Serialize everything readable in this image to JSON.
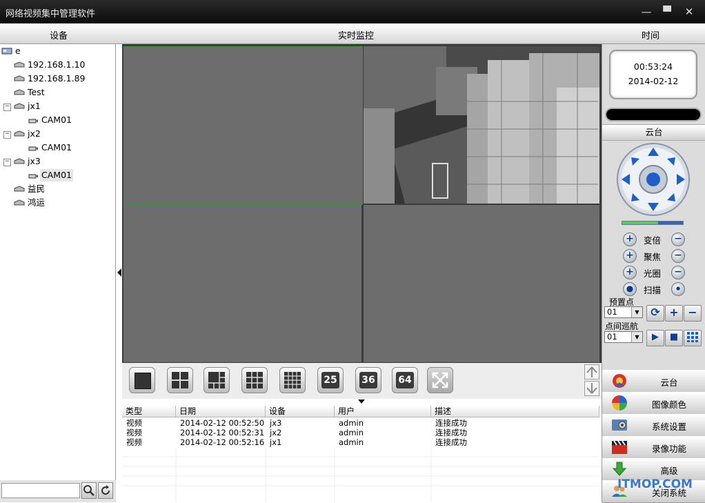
{
  "window": {
    "title": "网络视频集中管理软件",
    "controls": {
      "minimize": "—",
      "maximize": "▀",
      "close": "✕"
    }
  },
  "header": {
    "device": "设备",
    "monitor": "实时监控",
    "time": "时间"
  },
  "tree": {
    "root": "e",
    "nodes": [
      "192.168.1.10",
      "192.168.1.89",
      "Test",
      "jx1",
      "CAM01",
      "jx2",
      "CAM01",
      "jx3",
      "CAM01",
      "益民",
      "鸿运"
    ]
  },
  "layout_buttons": {
    "b25": "25",
    "b36": "36",
    "b64": "64"
  },
  "log": {
    "headers": [
      "类型",
      "日期",
      "设备",
      "用户",
      "描述"
    ],
    "rows": [
      [
        "视频",
        "2014-02-12 00:52:50",
        "jx3",
        "admin",
        "连接成功"
      ],
      [
        "视频",
        "2014-02-12 00:52:31",
        "jx2",
        "admin",
        "连接成功"
      ],
      [
        "视频",
        "2014-02-12 00:52:16",
        "jx1",
        "admin",
        "连接成功"
      ]
    ]
  },
  "clock": {
    "time": "00:53:24",
    "date": "2014-02-12"
  },
  "ptz": {
    "title": "云台",
    "zoom": "变倍",
    "focus": "聚焦",
    "iris": "光圈",
    "scan": "扫描",
    "preset_label": "预置点",
    "preset_value": "01",
    "cruise_label": "点间巡航",
    "cruise_value": "01"
  },
  "menu": {
    "ptz": "云台",
    "image_color": "图像颜色",
    "system_settings": "系统设置",
    "record": "录像功能",
    "advanced": "高级",
    "close_system": "关闭系统"
  },
  "watermark": "ITMOP.COM",
  "colors": {
    "selected_pane_border": "#3f8f3f",
    "accent_blue": "#1d5fc7"
  }
}
